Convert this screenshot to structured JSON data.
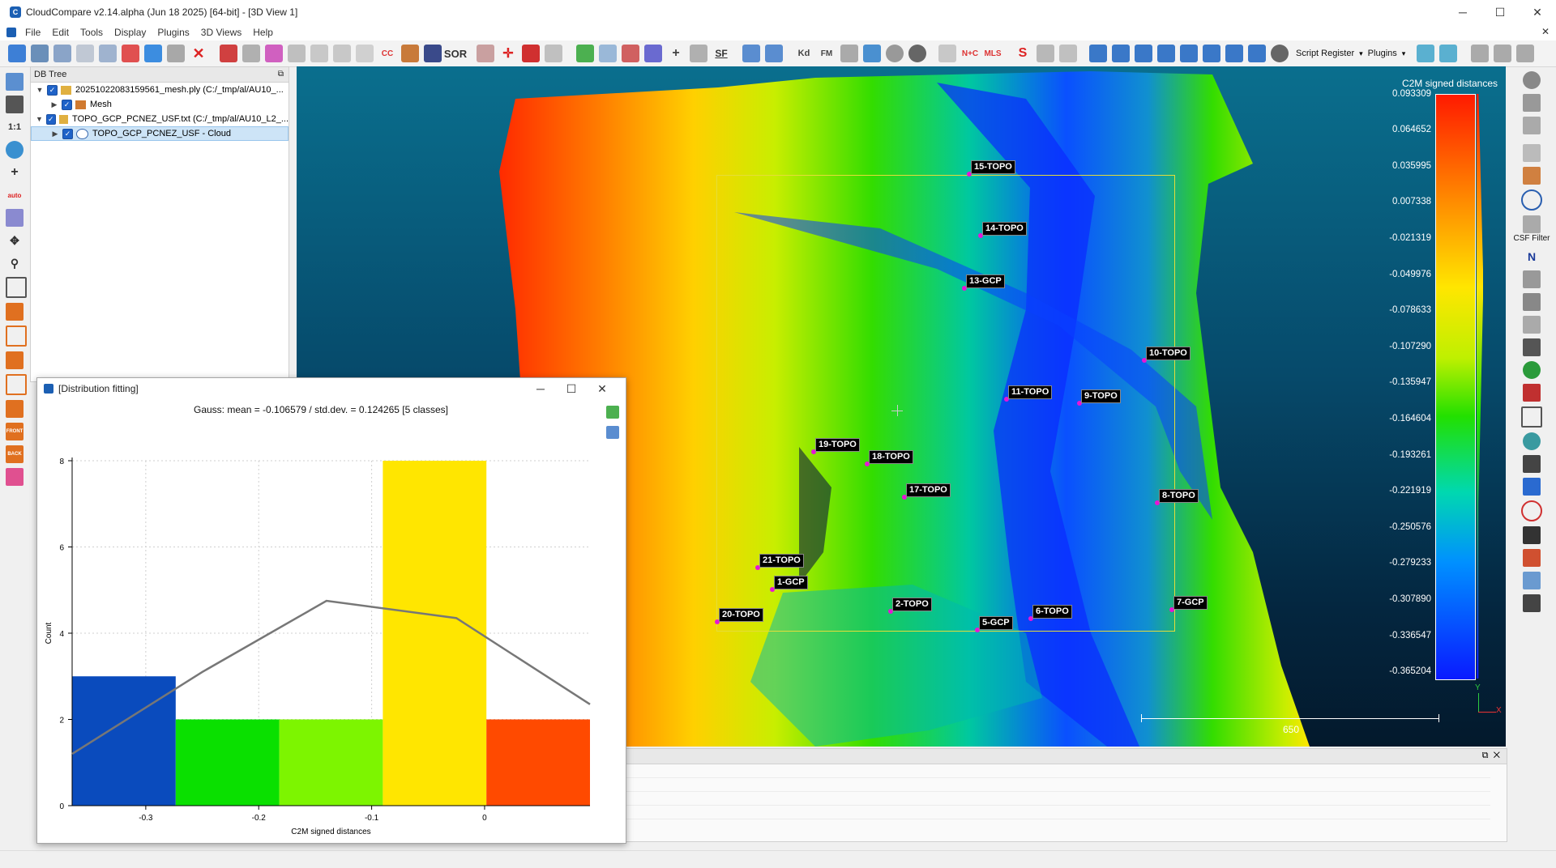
{
  "window": {
    "title": "CloudCompare v2.14.alpha (Jun 18 2025) [64-bit] - [3D View 1]",
    "btn_min": "─",
    "btn_max": "☐",
    "btn_close": "✕"
  },
  "menu": [
    "File",
    "Edit",
    "Tools",
    "Display",
    "Plugins",
    "3D Views",
    "Help"
  ],
  "menu_close": "✕",
  "toolbar": {
    "sor_label": "SOR",
    "cc_label": "CC",
    "sf_label": "SF",
    "kd_label": "Kd",
    "fm_label": "FM",
    "nc_label": "N+C",
    "mls_label": "MLS",
    "script_register": "Script Register",
    "plugins": "Plugins",
    "dropdown_caret": "▾"
  },
  "left_tools": {
    "one_to_one": "1:1",
    "auto": "auto",
    "front": "FRONT",
    "back": "BACK"
  },
  "db_tree": {
    "title": "DB Tree",
    "float_icon": "⧉",
    "items": [
      {
        "label": "20251022083159561_mesh.ply (C:/_tmp/al/AU10_...",
        "level": 0,
        "expanded": true
      },
      {
        "label": "Mesh",
        "level": 1,
        "expanded": false
      },
      {
        "label": "TOPO_GCP_PCNEZ_USF.txt (C:/_tmp/al/AU10_L2_...",
        "level": 0,
        "expanded": true
      },
      {
        "label": "TOPO_GCP_PCNEZ_USF - Cloud",
        "level": 1,
        "expanded": false,
        "selected": true
      }
    ]
  },
  "view3d": {
    "scalebar_title": "C2M signed distances",
    "scalebar_labels": [
      "0.093309",
      "0.064652",
      "0.035995",
      "0.007338",
      "-0.021319",
      "-0.049976",
      "-0.078633",
      "-0.107290",
      "-0.135947",
      "-0.164604",
      "-0.193261",
      "-0.221919",
      "-0.250576",
      "-0.279233",
      "-0.307890",
      "-0.336547",
      "-0.365204"
    ],
    "scale_length": "650",
    "axis_x": "X",
    "axis_y": "Y",
    "markers": [
      {
        "label": "15-TOPO"
      },
      {
        "label": "14-TOPO"
      },
      {
        "label": "13-GCP"
      },
      {
        "label": "10-TOPO"
      },
      {
        "label": "11-TOPO"
      },
      {
        "label": "9-TOPO"
      },
      {
        "label": "19-TOPO"
      },
      {
        "label": "18-TOPO"
      },
      {
        "label": "17-TOPO"
      },
      {
        "label": "8-TOPO"
      },
      {
        "label": "21-TOPO"
      },
      {
        "label": "1-GCP"
      },
      {
        "label": "2-TOPO"
      },
      {
        "label": "20-TOPO"
      },
      {
        "label": "5-GCP"
      },
      {
        "label": "6-TOPO"
      },
      {
        "label": "7-GCP"
      }
    ],
    "colors": {
      "red": "#ff2a00",
      "orange": "#ff8a00",
      "yellow": "#ffe600",
      "green": "#33dd00",
      "cyan": "#00c8c8",
      "blue": "#0a2aff"
    }
  },
  "right_tools": {
    "csf_filter": "CSF Filter",
    "n_label": "N"
  },
  "console": {
    "float_icon": "⧉",
    "close_icon": "✕"
  },
  "dialog": {
    "title": "[Distribution fitting]",
    "btn_min": "─",
    "btn_max": "☐",
    "btn_close": "✕",
    "chart_heading": "Gauss: mean = -0.106579 / std.dev. = 0.124265 [5 classes]"
  },
  "chart_data": {
    "type": "bar",
    "title": "",
    "xlabel": "C2M signed distances",
    "ylabel": "Count",
    "xlim": [
      -0.365204,
      0.093309
    ],
    "ylim": [
      0,
      8
    ],
    "x_ticks": [
      "-0.3",
      "-0.2",
      "-0.1",
      "0"
    ],
    "x_tick_values": [
      -0.3,
      -0.2,
      -0.1,
      0
    ],
    "y_ticks": [
      "0",
      "2",
      "4",
      "6",
      "8"
    ],
    "y_tick_values": [
      0,
      2,
      4,
      6,
      8
    ],
    "bins": [
      {
        "from": -0.365204,
        "to": -0.273501,
        "count": 3,
        "color": "#0a4bbd"
      },
      {
        "from": -0.273501,
        "to": -0.181799,
        "count": 2,
        "color": "#0ae000"
      },
      {
        "from": -0.181799,
        "to": -0.090096,
        "count": 2,
        "color": "#7df500"
      },
      {
        "from": -0.090096,
        "to": 0.001606,
        "count": 8,
        "color": "#ffe600"
      },
      {
        "from": 0.001606,
        "to": 0.093309,
        "count": 2,
        "color": "#ff4a00"
      }
    ],
    "gauss_curve": {
      "x": [
        -0.365204,
        -0.25,
        -0.14,
        -0.025,
        0.093309
      ],
      "y": [
        1.2,
        3.1,
        4.75,
        4.35,
        2.35
      ],
      "color": "#777777"
    },
    "grid": true
  }
}
